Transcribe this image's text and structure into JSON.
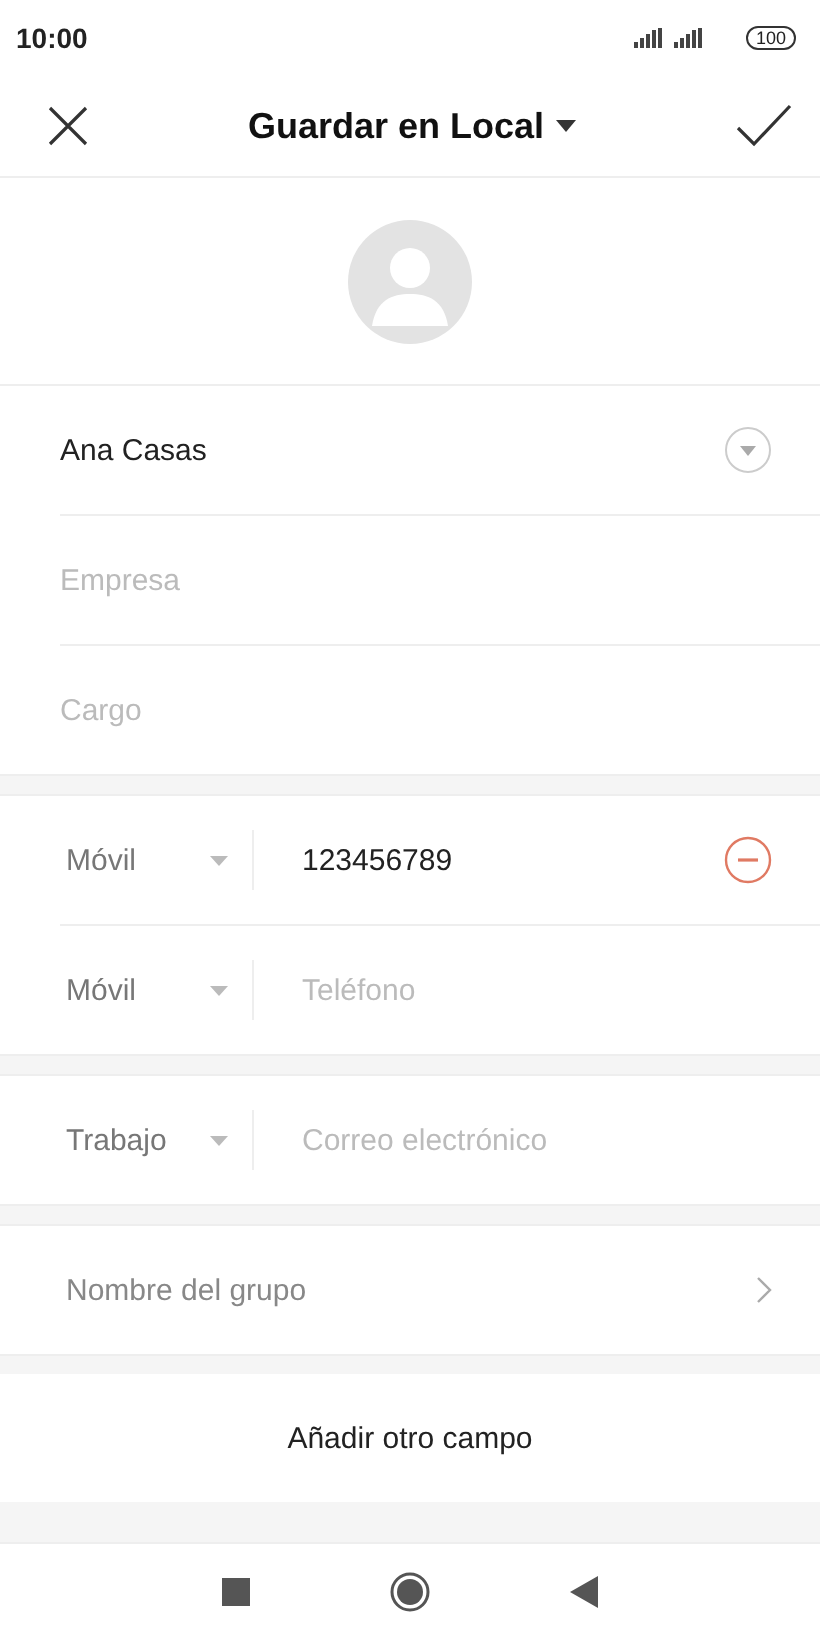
{
  "status_bar": {
    "time": "10:00",
    "battery": "100"
  },
  "header": {
    "title": "Guardar en Local"
  },
  "name_field": {
    "value": "Ana Casas"
  },
  "fields": [
    {
      "placeholder": "Empresa"
    },
    {
      "placeholder": "Cargo"
    }
  ],
  "phones": [
    {
      "type": "Móvil",
      "value": "123456789",
      "removable": true
    },
    {
      "type": "Móvil",
      "placeholder": "Teléfono",
      "removable": false
    }
  ],
  "email": {
    "type": "Trabajo",
    "placeholder": "Correo electrónico"
  },
  "group": {
    "placeholder": "Nombre del grupo"
  },
  "add_field_button": "Añadir otro campo"
}
